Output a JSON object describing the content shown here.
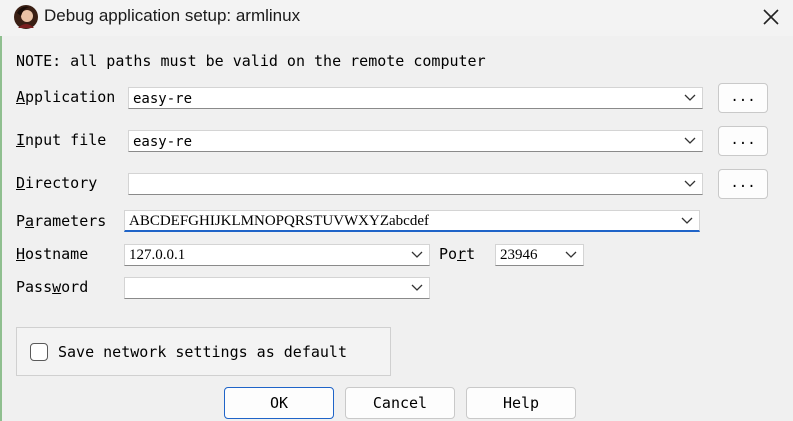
{
  "window": {
    "title": "Debug application setup: armlinux",
    "close_icon": "close-icon",
    "app_icon": "app-avatar-icon"
  },
  "note": "NOTE: all paths must be valid on the remote computer",
  "fields": {
    "application": {
      "label_pre": "",
      "label_key": "A",
      "label_post": "pplication",
      "value": "easy-re",
      "browse": "..."
    },
    "input_file": {
      "label_pre": "",
      "label_key": "I",
      "label_post": "nput file",
      "value": "easy-re",
      "browse": "..."
    },
    "directory": {
      "label_pre": "",
      "label_key": "D",
      "label_post": "irectory",
      "value": "",
      "browse": "..."
    },
    "parameters": {
      "label_pre": "P",
      "label_key": "a",
      "label_post": "rameters",
      "value": "ABCDEFGHIJKLMNOPQRSTUVWXYZabcdef"
    },
    "hostname": {
      "label_pre": "",
      "label_key": "H",
      "label_post": "ostname",
      "value": "127.0.0.1"
    },
    "port": {
      "label_pre": "Po",
      "label_key": "r",
      "label_post": "t",
      "value": "23946"
    },
    "password": {
      "label_pre": "Pass",
      "label_key": "w",
      "label_post": "ord",
      "value": ""
    }
  },
  "save_settings": {
    "label": "Save network settings as default",
    "checked": false
  },
  "buttons": {
    "ok": "OK",
    "cancel": "Cancel",
    "help": "Help"
  },
  "colors": {
    "accent": "#1f64c8"
  }
}
